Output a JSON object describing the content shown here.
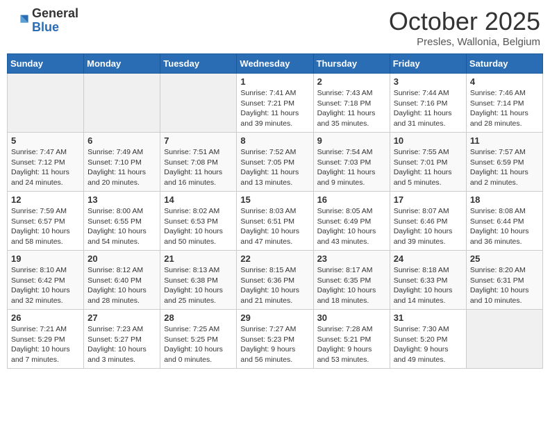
{
  "header": {
    "logo_general": "General",
    "logo_blue": "Blue",
    "month_title": "October 2025",
    "location": "Presles, Wallonia, Belgium"
  },
  "weekdays": [
    "Sunday",
    "Monday",
    "Tuesday",
    "Wednesday",
    "Thursday",
    "Friday",
    "Saturday"
  ],
  "weeks": [
    [
      {
        "day": "",
        "info": ""
      },
      {
        "day": "",
        "info": ""
      },
      {
        "day": "",
        "info": ""
      },
      {
        "day": "1",
        "info": "Sunrise: 7:41 AM\nSunset: 7:21 PM\nDaylight: 11 hours\nand 39 minutes."
      },
      {
        "day": "2",
        "info": "Sunrise: 7:43 AM\nSunset: 7:18 PM\nDaylight: 11 hours\nand 35 minutes."
      },
      {
        "day": "3",
        "info": "Sunrise: 7:44 AM\nSunset: 7:16 PM\nDaylight: 11 hours\nand 31 minutes."
      },
      {
        "day": "4",
        "info": "Sunrise: 7:46 AM\nSunset: 7:14 PM\nDaylight: 11 hours\nand 28 minutes."
      }
    ],
    [
      {
        "day": "5",
        "info": "Sunrise: 7:47 AM\nSunset: 7:12 PM\nDaylight: 11 hours\nand 24 minutes."
      },
      {
        "day": "6",
        "info": "Sunrise: 7:49 AM\nSunset: 7:10 PM\nDaylight: 11 hours\nand 20 minutes."
      },
      {
        "day": "7",
        "info": "Sunrise: 7:51 AM\nSunset: 7:08 PM\nDaylight: 11 hours\nand 16 minutes."
      },
      {
        "day": "8",
        "info": "Sunrise: 7:52 AM\nSunset: 7:05 PM\nDaylight: 11 hours\nand 13 minutes."
      },
      {
        "day": "9",
        "info": "Sunrise: 7:54 AM\nSunset: 7:03 PM\nDaylight: 11 hours\nand 9 minutes."
      },
      {
        "day": "10",
        "info": "Sunrise: 7:55 AM\nSunset: 7:01 PM\nDaylight: 11 hours\nand 5 minutes."
      },
      {
        "day": "11",
        "info": "Sunrise: 7:57 AM\nSunset: 6:59 PM\nDaylight: 11 hours\nand 2 minutes."
      }
    ],
    [
      {
        "day": "12",
        "info": "Sunrise: 7:59 AM\nSunset: 6:57 PM\nDaylight: 10 hours\nand 58 minutes."
      },
      {
        "day": "13",
        "info": "Sunrise: 8:00 AM\nSunset: 6:55 PM\nDaylight: 10 hours\nand 54 minutes."
      },
      {
        "day": "14",
        "info": "Sunrise: 8:02 AM\nSunset: 6:53 PM\nDaylight: 10 hours\nand 50 minutes."
      },
      {
        "day": "15",
        "info": "Sunrise: 8:03 AM\nSunset: 6:51 PM\nDaylight: 10 hours\nand 47 minutes."
      },
      {
        "day": "16",
        "info": "Sunrise: 8:05 AM\nSunset: 6:49 PM\nDaylight: 10 hours\nand 43 minutes."
      },
      {
        "day": "17",
        "info": "Sunrise: 8:07 AM\nSunset: 6:46 PM\nDaylight: 10 hours\nand 39 minutes."
      },
      {
        "day": "18",
        "info": "Sunrise: 8:08 AM\nSunset: 6:44 PM\nDaylight: 10 hours\nand 36 minutes."
      }
    ],
    [
      {
        "day": "19",
        "info": "Sunrise: 8:10 AM\nSunset: 6:42 PM\nDaylight: 10 hours\nand 32 minutes."
      },
      {
        "day": "20",
        "info": "Sunrise: 8:12 AM\nSunset: 6:40 PM\nDaylight: 10 hours\nand 28 minutes."
      },
      {
        "day": "21",
        "info": "Sunrise: 8:13 AM\nSunset: 6:38 PM\nDaylight: 10 hours\nand 25 minutes."
      },
      {
        "day": "22",
        "info": "Sunrise: 8:15 AM\nSunset: 6:36 PM\nDaylight: 10 hours\nand 21 minutes."
      },
      {
        "day": "23",
        "info": "Sunrise: 8:17 AM\nSunset: 6:35 PM\nDaylight: 10 hours\nand 18 minutes."
      },
      {
        "day": "24",
        "info": "Sunrise: 8:18 AM\nSunset: 6:33 PM\nDaylight: 10 hours\nand 14 minutes."
      },
      {
        "day": "25",
        "info": "Sunrise: 8:20 AM\nSunset: 6:31 PM\nDaylight: 10 hours\nand 10 minutes."
      }
    ],
    [
      {
        "day": "26",
        "info": "Sunrise: 7:21 AM\nSunset: 5:29 PM\nDaylight: 10 hours\nand 7 minutes."
      },
      {
        "day": "27",
        "info": "Sunrise: 7:23 AM\nSunset: 5:27 PM\nDaylight: 10 hours\nand 3 minutes."
      },
      {
        "day": "28",
        "info": "Sunrise: 7:25 AM\nSunset: 5:25 PM\nDaylight: 10 hours\nand 0 minutes."
      },
      {
        "day": "29",
        "info": "Sunrise: 7:27 AM\nSunset: 5:23 PM\nDaylight: 9 hours\nand 56 minutes."
      },
      {
        "day": "30",
        "info": "Sunrise: 7:28 AM\nSunset: 5:21 PM\nDaylight: 9 hours\nand 53 minutes."
      },
      {
        "day": "31",
        "info": "Sunrise: 7:30 AM\nSunset: 5:20 PM\nDaylight: 9 hours\nand 49 minutes."
      },
      {
        "day": "",
        "info": ""
      }
    ]
  ]
}
